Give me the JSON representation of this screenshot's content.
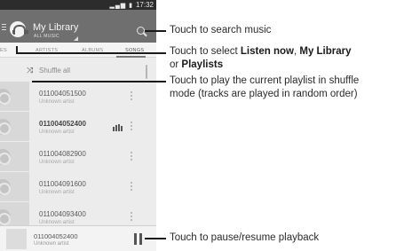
{
  "phone": {
    "status_time": "17:32",
    "app_title": "My Library",
    "app_subtitle": "ALL MUSIC",
    "tabs": [
      {
        "label": "ES",
        "active": false
      },
      {
        "label": "ARTISTS",
        "active": false
      },
      {
        "label": "ALBUMS",
        "active": false
      },
      {
        "label": "SONGS",
        "active": true
      }
    ],
    "shuffle_label": "Shuffle all",
    "tracks": [
      {
        "title": "011004051500",
        "artist": "Unknown artist",
        "playing": false
      },
      {
        "title": "011004052400",
        "artist": "Unknown artist",
        "playing": true
      },
      {
        "title": "011004082900",
        "artist": "Unknown artist",
        "playing": false
      },
      {
        "title": "011004091600",
        "artist": "Unknown artist",
        "playing": false
      },
      {
        "title": "011004093400",
        "artist": "Unknown artist",
        "playing": false
      }
    ],
    "now_playing": {
      "title": "011004052400",
      "artist": "Unknown artist"
    },
    "icons": [
      "menu-icon",
      "headphones-icon",
      "search-icon",
      "shuffle-icon",
      "more-icon",
      "equalizer-icon",
      "pause-icon"
    ]
  },
  "callouts": {
    "search": "Touch to search music",
    "select_prefix": "Touch to select ",
    "select_listen_now": "Listen now",
    "select_comma": ", ",
    "select_my_library": "My Library",
    "select_or": "or ",
    "select_playlists": "Playlists",
    "shuffle_line1": "Touch to play the current playlist in shuffle",
    "shuffle_line2": "mode (tracks are played in random order)",
    "pause": "Touch to pause/resume playback"
  }
}
